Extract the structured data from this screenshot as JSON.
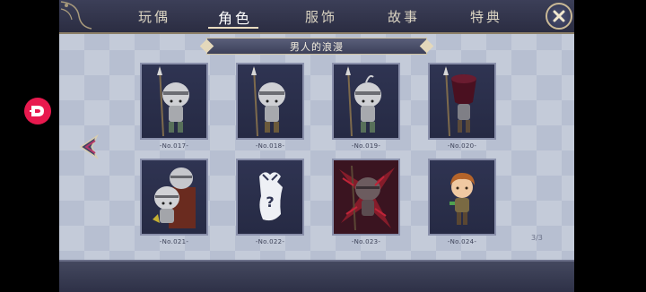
{
  "tabs": [
    {
      "label": "玩偶",
      "active": false
    },
    {
      "label": "角色",
      "active": true
    },
    {
      "label": "服饰",
      "active": false
    },
    {
      "label": "故事",
      "active": false
    },
    {
      "label": "特典",
      "active": false
    }
  ],
  "close_icon": "close-icon",
  "collection_title": "男人的浪漫",
  "cards": [
    {
      "number": "-No.017-",
      "portrait": "armored-spearman-1",
      "state": "unlocked"
    },
    {
      "number": "-No.018-",
      "portrait": "armored-spearman-2",
      "state": "unlocked"
    },
    {
      "number": "-No.019-",
      "portrait": "armored-spearman-3",
      "state": "unlocked"
    },
    {
      "number": "-No.020-",
      "portrait": "dark-bell-figure",
      "state": "unlocked"
    },
    {
      "number": "-No.021-",
      "portrait": "armored-duo-throne",
      "state": "unlocked"
    },
    {
      "number": "-No.022-",
      "portrait": "locked-silhouette",
      "state": "locked"
    },
    {
      "number": "-No.023-",
      "portrait": "cursed-knight",
      "state": "cursed"
    },
    {
      "number": "-No.024-",
      "portrait": "ginger-boy",
      "state": "unlocked"
    }
  ],
  "pager": "3/3",
  "colors": {
    "panel": "#b7bfd1",
    "tabbar": "#2b2d42",
    "card_bg": "#2a2e4a",
    "side_button": "#e8194e",
    "gold_trim": "#c9b896"
  }
}
